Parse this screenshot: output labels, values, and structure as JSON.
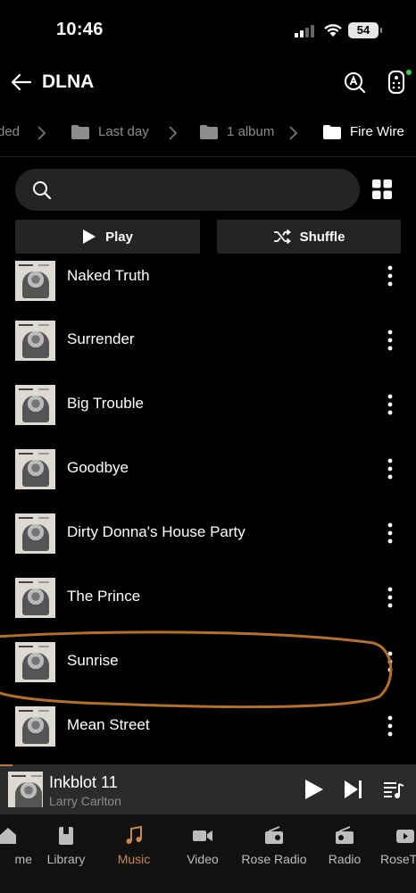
{
  "status_bar": {
    "time": "10:46",
    "battery": "54"
  },
  "header": {
    "title": "DLNA"
  },
  "breadcrumb": {
    "items": [
      {
        "label": "ded"
      },
      {
        "label": "Last day"
      },
      {
        "label": "1 album"
      },
      {
        "label": "Fire Wire"
      }
    ]
  },
  "search": {
    "placeholder": ""
  },
  "actions": {
    "play_label": "Play",
    "shuffle_label": "Shuffle"
  },
  "tracks": [
    {
      "title": "Naked Truth"
    },
    {
      "title": "Surrender"
    },
    {
      "title": "Big Trouble"
    },
    {
      "title": "Goodbye"
    },
    {
      "title": "Dirty Donna's House Party"
    },
    {
      "title": "The Prince"
    },
    {
      "title": "Sunrise"
    },
    {
      "title": "Mean Street"
    }
  ],
  "annotation_color": "#b46f28",
  "now_playing": {
    "title": "Inkblot 11",
    "artist": "Larry Carlton"
  },
  "nav": {
    "items": [
      {
        "label": "me",
        "icon": "home-icon"
      },
      {
        "label": "Library",
        "icon": "library-icon"
      },
      {
        "label": "Music",
        "icon": "music-note-icon",
        "active": true
      },
      {
        "label": "Video",
        "icon": "video-icon"
      },
      {
        "label": "Rose Radio",
        "icon": "radio-icon"
      },
      {
        "label": "Radio",
        "icon": "radio-icon"
      },
      {
        "label": "RoseT",
        "icon": "rose-tube-icon"
      }
    ]
  },
  "colors": {
    "accent": "#c8894a",
    "background": "#000000",
    "surface": "#242424"
  }
}
